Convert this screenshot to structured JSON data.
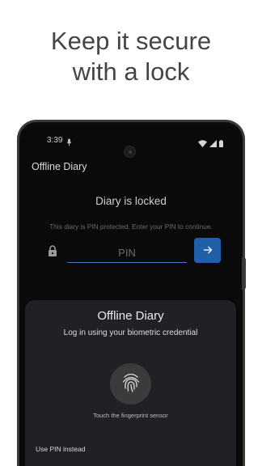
{
  "headline": {
    "line1": "Keep it secure",
    "line2": "with a lock"
  },
  "status_bar": {
    "time": "3:39"
  },
  "app": {
    "title": "Offline Diary"
  },
  "lock_screen": {
    "title": "Diary is locked",
    "description": "This diary is PIN protected. Enter your PIN to continue.",
    "pin_placeholder": "PIN",
    "submit_icon": "arrow-right-icon"
  },
  "biometric_sheet": {
    "title": "Offline Diary",
    "subtitle": "Log in using your biometric credential",
    "hint": "Touch the fingerprint sensor",
    "use_pin_label": "Use PIN instead"
  },
  "colors": {
    "accent": "#2160a8",
    "field_underline": "#4a77c4",
    "screen_background": "#0a0a0a",
    "sheet_background": "#202124"
  }
}
